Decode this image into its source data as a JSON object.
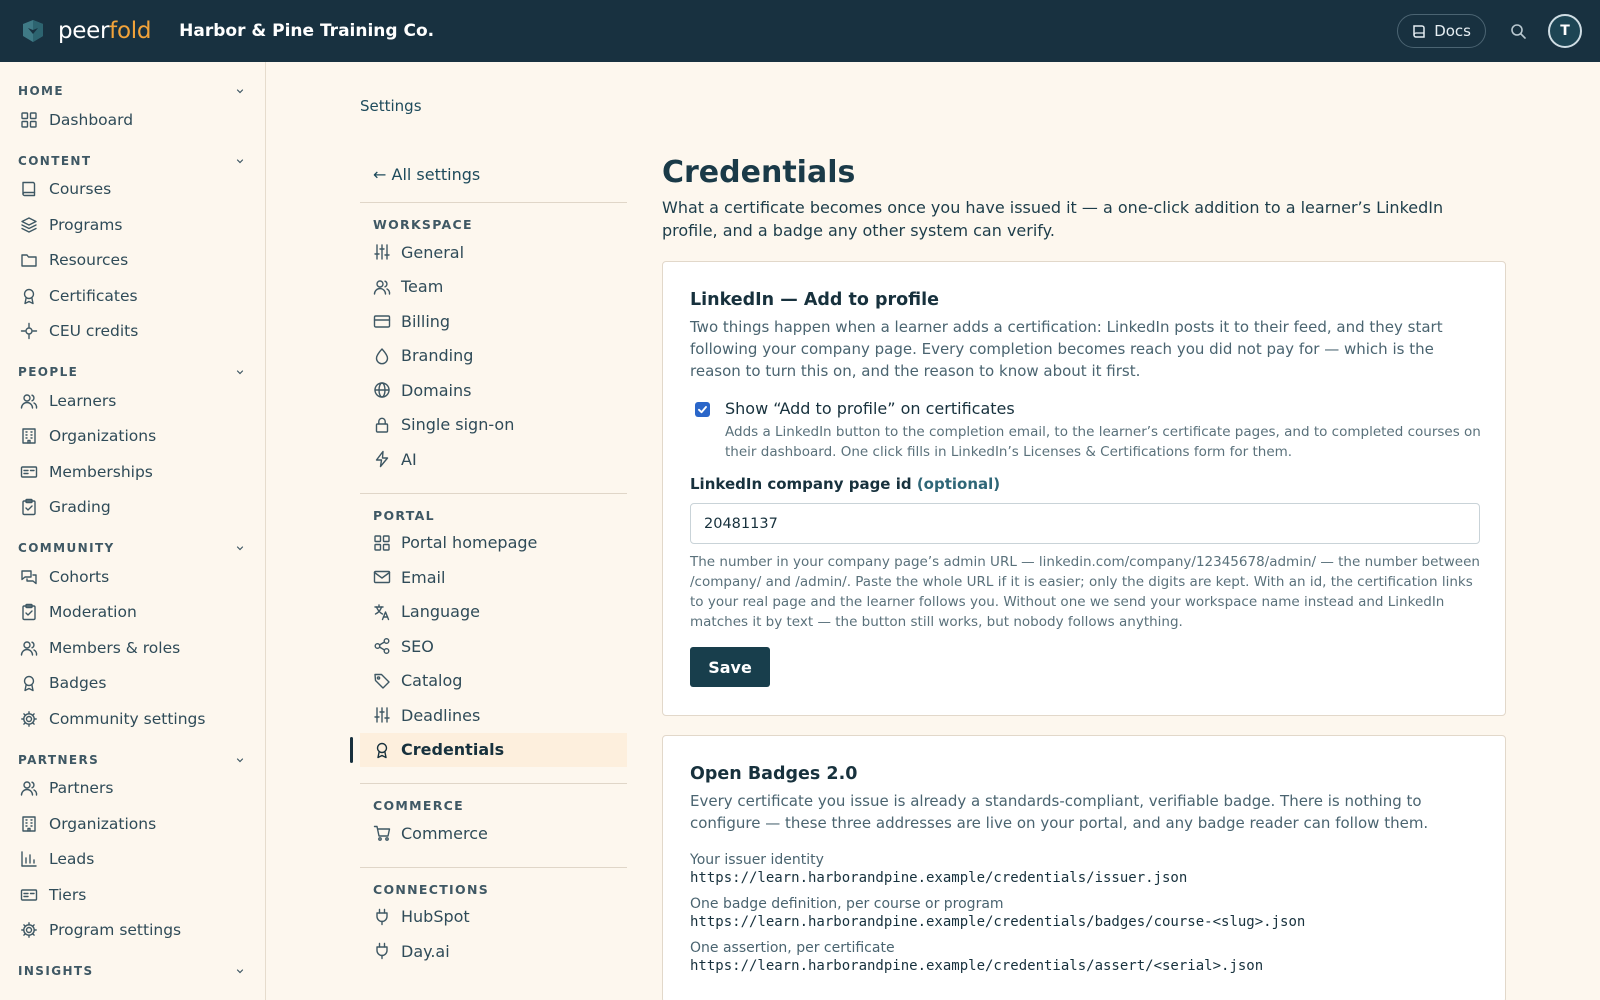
{
  "topbar": {
    "logo_word_a": "peer",
    "logo_word_b": "fold",
    "workspace_name": "Harbor & Pine Training Co.",
    "docs_label": "Docs",
    "avatar_initial": "T"
  },
  "sidebar": {
    "sections": [
      {
        "title": "HOME",
        "items": [
          {
            "label": "Dashboard",
            "icon": "grid-icon"
          }
        ]
      },
      {
        "title": "CONTENT",
        "items": [
          {
            "label": "Courses",
            "icon": "book-icon"
          },
          {
            "label": "Programs",
            "icon": "layers-icon"
          },
          {
            "label": "Resources",
            "icon": "folder-icon"
          },
          {
            "label": "Certificates",
            "icon": "award-icon"
          },
          {
            "label": "CEU credits",
            "icon": "target-icon"
          }
        ]
      },
      {
        "title": "PEOPLE",
        "items": [
          {
            "label": "Learners",
            "icon": "users-icon"
          },
          {
            "label": "Organizations",
            "icon": "building-icon"
          },
          {
            "label": "Memberships",
            "icon": "id-card-icon"
          },
          {
            "label": "Grading",
            "icon": "clipboard-icon"
          }
        ]
      },
      {
        "title": "COMMUNITY",
        "items": [
          {
            "label": "Cohorts",
            "icon": "chat-icon"
          },
          {
            "label": "Moderation",
            "icon": "clipboard-check-icon"
          },
          {
            "label": "Members & roles",
            "icon": "users-icon"
          },
          {
            "label": "Badges",
            "icon": "award-icon"
          },
          {
            "label": "Community settings",
            "icon": "gear-icon"
          }
        ]
      },
      {
        "title": "PARTNERS",
        "items": [
          {
            "label": "Partners",
            "icon": "users-icon"
          },
          {
            "label": "Organizations",
            "icon": "building-icon"
          },
          {
            "label": "Leads",
            "icon": "bar-chart-icon"
          },
          {
            "label": "Tiers",
            "icon": "id-card-icon"
          },
          {
            "label": "Program settings",
            "icon": "gear-icon"
          }
        ]
      },
      {
        "title": "INSIGHTS",
        "items": []
      }
    ]
  },
  "breadcrumb": "Settings",
  "settings_nav": {
    "back_label": "← All settings",
    "groups": [
      {
        "title": "WORKSPACE",
        "items": [
          {
            "label": "General",
            "icon": "sliders-icon"
          },
          {
            "label": "Team",
            "icon": "users-icon"
          },
          {
            "label": "Billing",
            "icon": "credit-card-icon"
          },
          {
            "label": "Branding",
            "icon": "droplet-icon"
          },
          {
            "label": "Domains",
            "icon": "globe-icon"
          },
          {
            "label": "Single sign-on",
            "icon": "lock-icon"
          },
          {
            "label": "AI",
            "icon": "bolt-icon"
          }
        ]
      },
      {
        "title": "PORTAL",
        "items": [
          {
            "label": "Portal homepage",
            "icon": "grid-icon"
          },
          {
            "label": "Email",
            "icon": "mail-icon"
          },
          {
            "label": "Language",
            "icon": "translate-icon"
          },
          {
            "label": "SEO",
            "icon": "share-icon"
          },
          {
            "label": "Catalog",
            "icon": "tag-icon"
          },
          {
            "label": "Deadlines",
            "icon": "sliders-icon"
          },
          {
            "label": "Credentials",
            "icon": "award-icon",
            "active": true
          }
        ]
      },
      {
        "title": "COMMERCE",
        "items": [
          {
            "label": "Commerce",
            "icon": "cart-icon"
          }
        ]
      },
      {
        "title": "CONNECTIONS",
        "items": [
          {
            "label": "HubSpot",
            "icon": "plug-icon"
          },
          {
            "label": "Day.ai",
            "icon": "plug-icon"
          }
        ]
      }
    ]
  },
  "page": {
    "title": "Credentials",
    "description": "What a certificate becomes once you have issued it — a one-click addition to a learner’s LinkedIn profile, and a badge any other system can verify."
  },
  "linkedin_card": {
    "title": "LinkedIn — Add to profile",
    "intro": "Two things happen when a learner adds a certification: LinkedIn posts it to their feed, and they start following your company page. Every completion becomes reach you did not pay for — which is the reason to turn this on, and the reason to know about it first.",
    "checkbox_label": "Show “Add to profile” on certificates",
    "checkbox_checked": true,
    "checkbox_help": "Adds a LinkedIn button to the completion email, to the learner’s certificate pages, and to completed courses on their dashboard. One click fills in LinkedIn’s Licenses & Certifications form for them.",
    "field_label": "LinkedIn company page id",
    "field_optional": "(optional)",
    "field_value": "20481137",
    "field_help": "The number in your company page’s admin URL — linkedin.com/company/12345678/admin/ — the number between /company/ and /admin/. Paste the whole URL if it is easier; only the digits are kept. With an id, the certification links to your real page and the learner follows you. Without one we send your workspace name instead and LinkedIn matches it by text — the button still works, but nobody follows anything.",
    "save_label": "Save"
  },
  "badges_card": {
    "title": "Open Badges 2.0",
    "intro": "Every certificate you issue is already a standards-compliant, verifiable badge. There is nothing to configure — these three addresses are live on your portal, and any badge reader can follow them.",
    "addresses": [
      {
        "label": "Your issuer identity",
        "url": "https://learn.harborandpine.example/credentials/issuer.json"
      },
      {
        "label": "One badge definition, per course or program",
        "url": "https://learn.harborandpine.example/credentials/badges/course-<slug>.json"
      },
      {
        "label": "One assertion, per certificate",
        "url": "https://learn.harborandpine.example/credentials/assert/<serial>.json"
      }
    ]
  },
  "colors": {
    "topbar_bg": "#183140",
    "accent_orange": "#f2a33a",
    "page_bg": "#fdf7ee",
    "active_item_bg": "#fdefdd",
    "primary_button": "#183e4c",
    "checkbox": "#2a66c9"
  }
}
